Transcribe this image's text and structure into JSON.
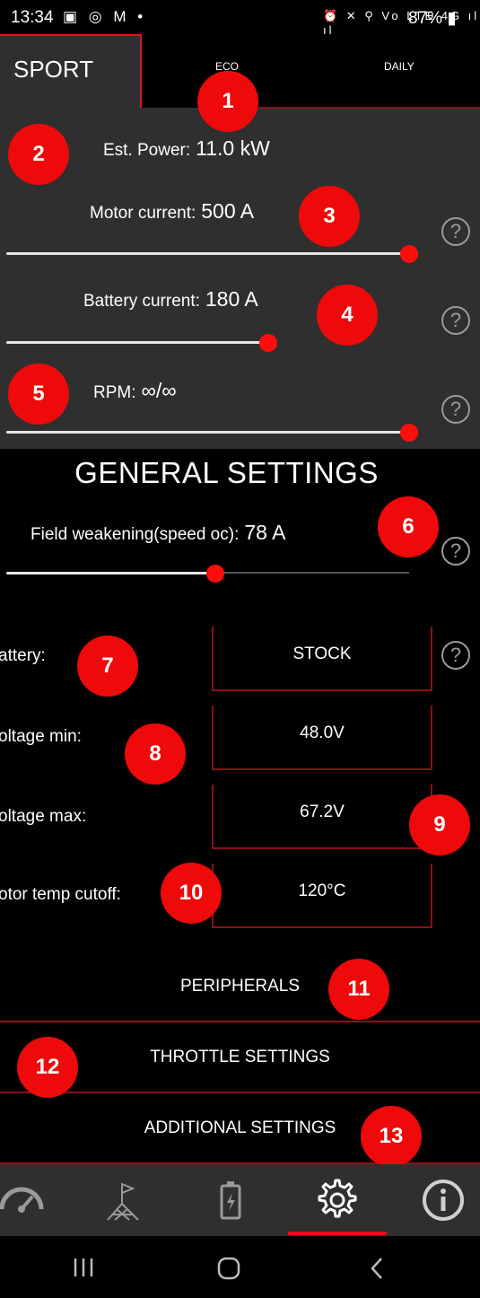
{
  "status_bar": {
    "time": "13:34",
    "left_icons": "▣ ◎ M •",
    "right_icons": "⏰ ✕ ⚲ Vo LTE 4G ıl ıl",
    "battery": "87%"
  },
  "tabs": [
    {
      "label": "SPORT",
      "active": true
    },
    {
      "label": "ECO",
      "active": false
    },
    {
      "label": "DAILY",
      "active": false
    }
  ],
  "mode_settings": {
    "est_power": {
      "label": "Est. Power:",
      "value": "11.0 kW"
    },
    "motor_current": {
      "label": "Motor current:",
      "value": "500 A",
      "level": 1.0
    },
    "battery_current": {
      "label": "Battery current:",
      "value": "180 A",
      "level": 0.65
    },
    "rpm": {
      "label": "RPM:",
      "value": "∞/∞",
      "level": 1.0
    }
  },
  "general_settings": {
    "title": "GENERAL SETTINGS",
    "field_weakening": {
      "label": "Field weakening(speed oc):",
      "value": "78 A",
      "level": 0.52
    },
    "rows": [
      {
        "label": "attery:",
        "value": "STOCK"
      },
      {
        "label": "oltage min:",
        "value": "48.0V"
      },
      {
        "label": "oltage max:",
        "value": "67.2V"
      },
      {
        "label": "otor temp cutoff:",
        "value": "120°C"
      }
    ]
  },
  "menu": {
    "peripherals": "PERIPHERALS",
    "throttle": "THROTTLE SETTINGS",
    "additional": "ADDITIONAL SETTINGS"
  },
  "help_symbol": "?",
  "markers": [
    "1",
    "2",
    "3",
    "4",
    "5",
    "6",
    "7",
    "8",
    "9",
    "10",
    "11",
    "12",
    "13"
  ],
  "nav": {
    "items": [
      "speedometer-icon",
      "map-flag-icon",
      "battery-icon",
      "settings-icon",
      "info-icon"
    ],
    "active_index": 3
  },
  "colors": {
    "accent": "#e0101a",
    "panel": "#2f2f2f",
    "background": "#000000",
    "marker": "#ee0a0a"
  }
}
